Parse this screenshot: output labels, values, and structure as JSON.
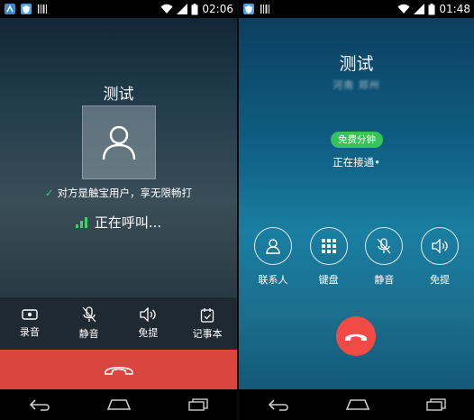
{
  "left_screen": {
    "status_time": "02:06",
    "contact_name": "测试",
    "touch_notice": "对方是触宝用户，享无限畅打",
    "calling_status": "正在呼叫...",
    "actions": [
      {
        "label": "录音",
        "icon": "record-icon"
      },
      {
        "label": "静音",
        "icon": "mute-mic-icon"
      },
      {
        "label": "免提",
        "icon": "speaker-icon"
      },
      {
        "label": "记事本",
        "icon": "notepad-icon"
      }
    ],
    "end_call_color": "#d9463f"
  },
  "right_screen": {
    "status_time": "01:48",
    "contact_name": "测试",
    "number_blurred": "河南 郑州",
    "free_badge": "免费分钟",
    "status": "正在接通•",
    "actions": [
      {
        "label": "联系人",
        "icon": "contact-icon"
      },
      {
        "label": "键盘",
        "icon": "keypad-icon"
      },
      {
        "label": "静音",
        "icon": "mute-mic-icon"
      },
      {
        "label": "免提",
        "icon": "speaker-icon"
      }
    ],
    "hangup_color": "#f24a45",
    "badge_color": "#35c35a"
  },
  "nav_icons": [
    "back-icon",
    "home-icon",
    "recent-apps-icon"
  ]
}
